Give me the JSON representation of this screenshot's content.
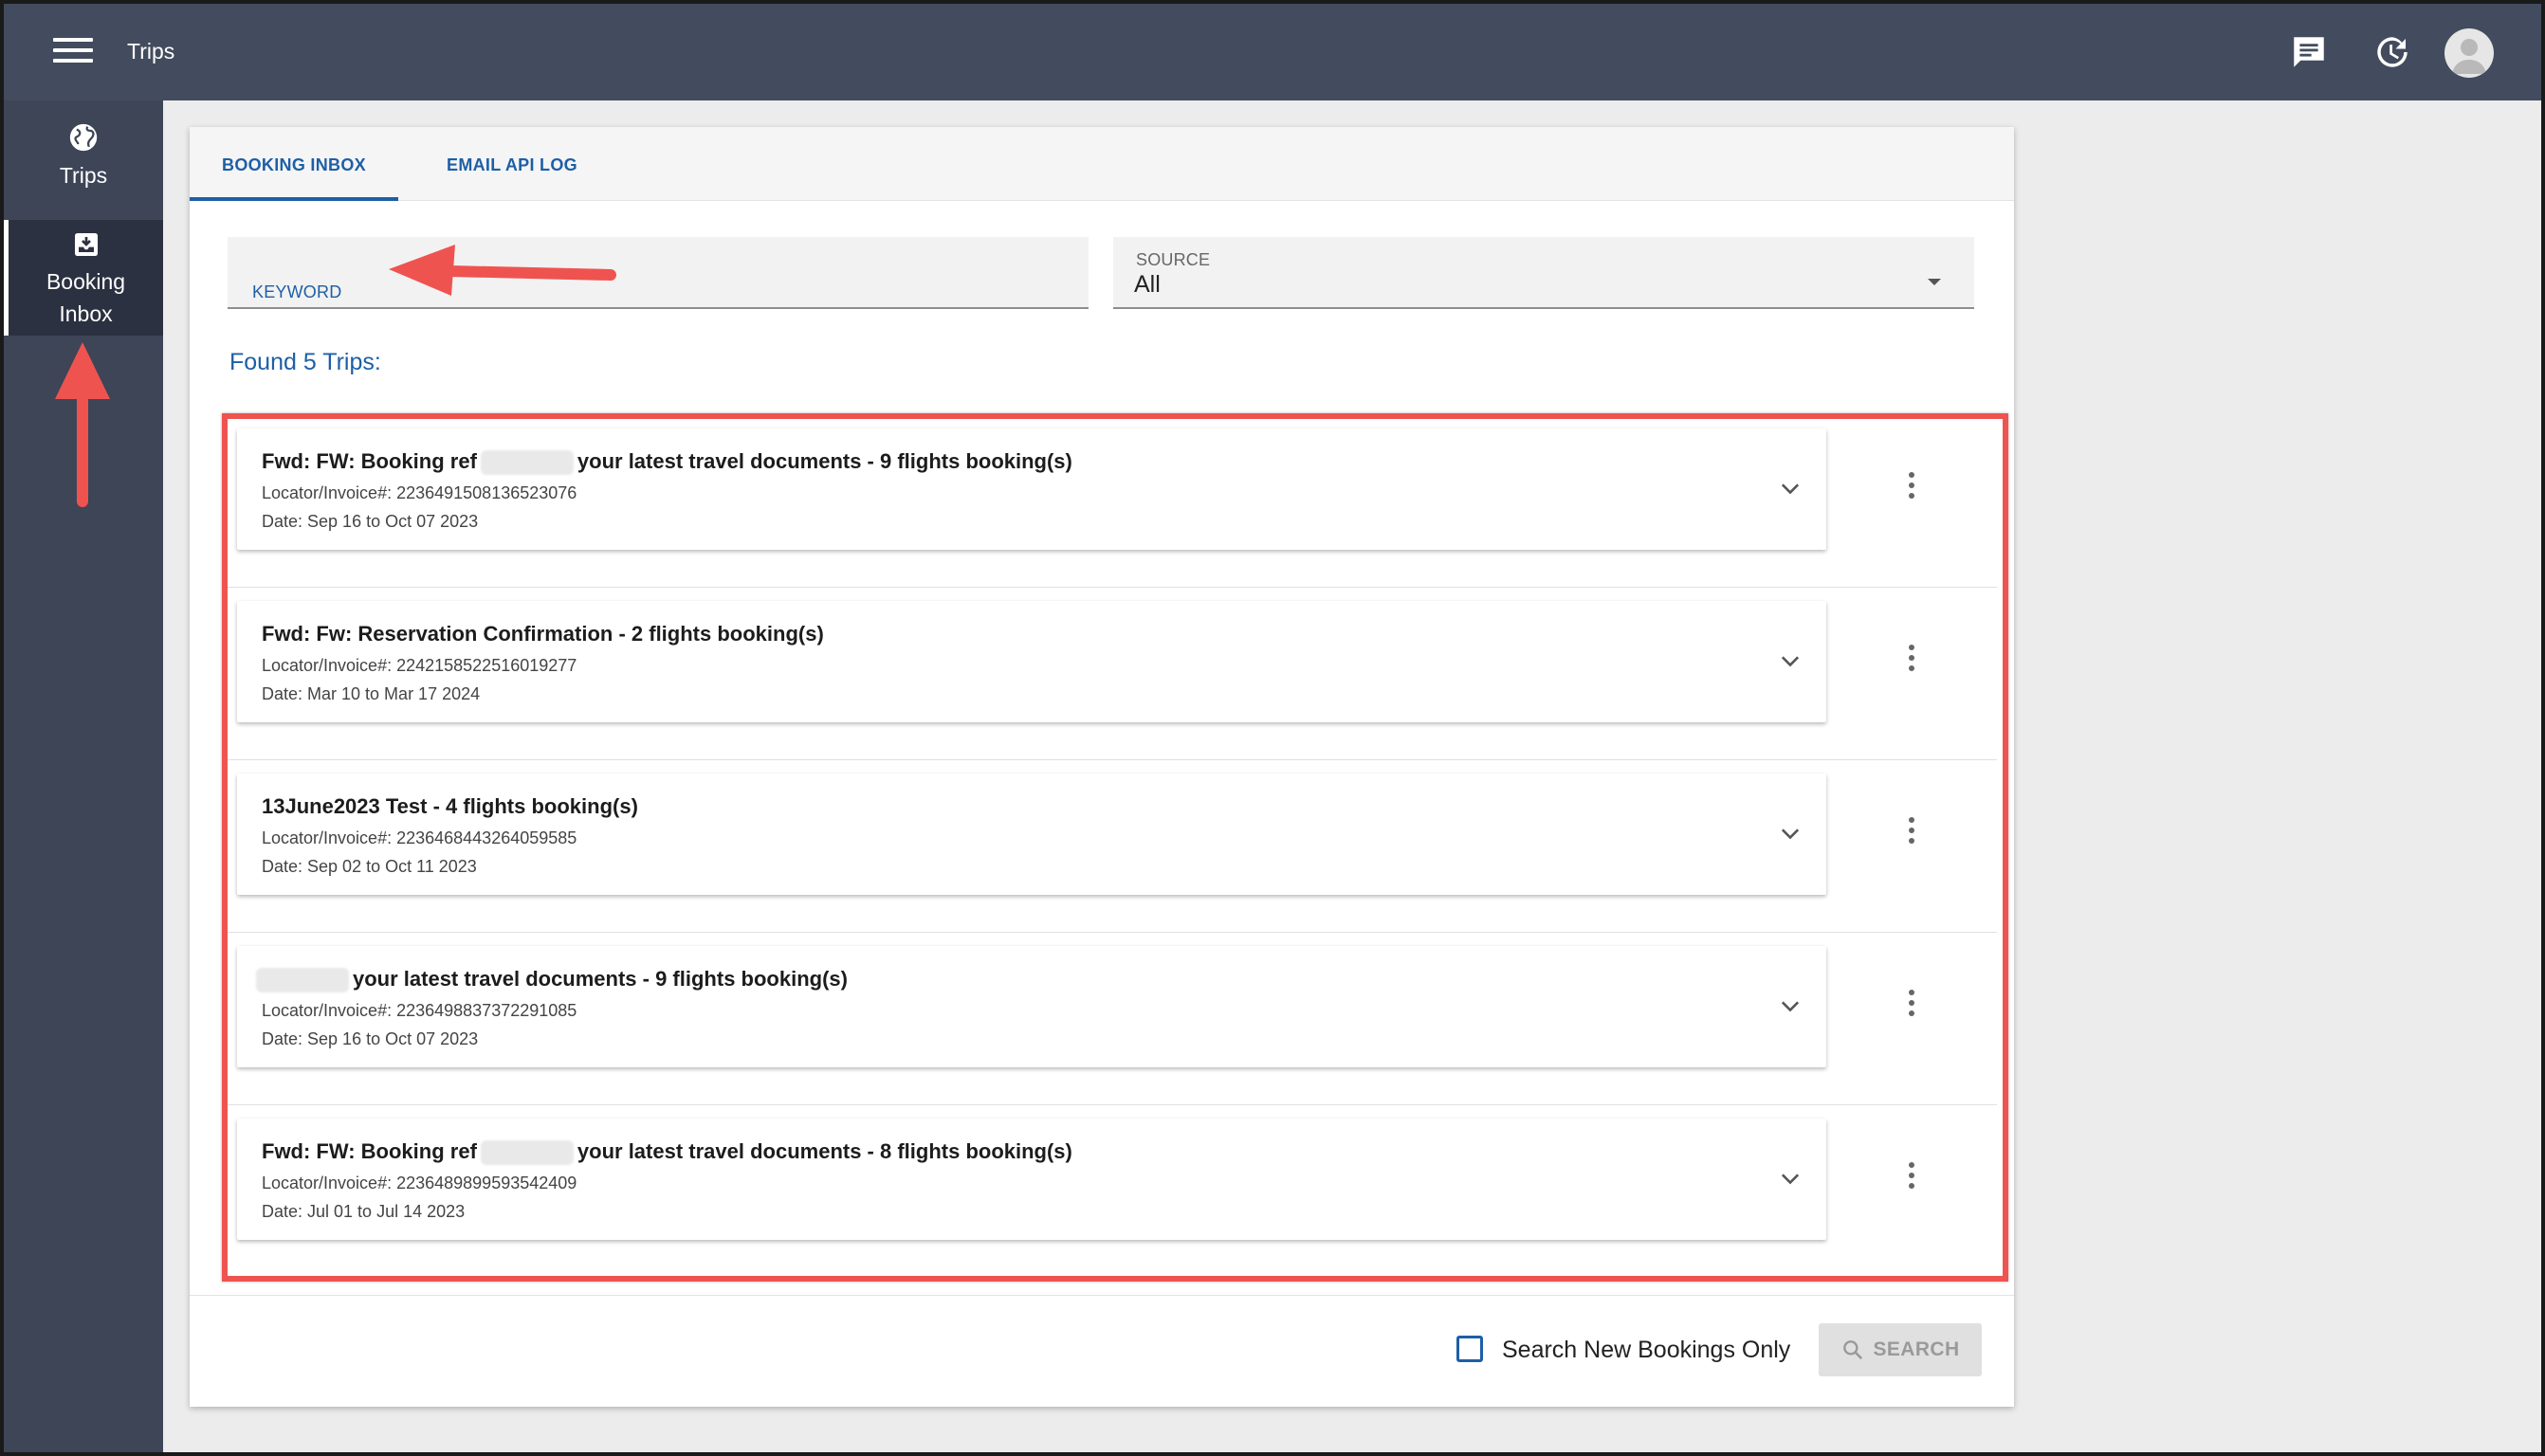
{
  "header": {
    "title": "Trips",
    "chat_icon": "chat-icon",
    "history_icon": "history-icon"
  },
  "sidebar": {
    "items": [
      {
        "icon": "globe-icon",
        "label": "Trips"
      },
      {
        "icon": "inbox-download-icon",
        "label_line1": "Booking",
        "label_line2": "Inbox",
        "active": true
      }
    ]
  },
  "tabs": [
    {
      "label": "BOOKING INBOX",
      "active": true
    },
    {
      "label": "EMAIL API LOG",
      "active": false
    }
  ],
  "filters": {
    "keyword": {
      "label": "KEYWORD",
      "value": ""
    },
    "source": {
      "label": "SOURCE",
      "value": "All"
    }
  },
  "results": {
    "summary": "Found 5 Trips:"
  },
  "trips": [
    {
      "title_prefix": "Fwd: FW: Booking ref",
      "title_suffix": "your latest travel documents - 9 flights booking(s)",
      "locator": "Locator/Invoice#: 2236491508136523076",
      "date": "Date: Sep 16 to Oct 07 2023"
    },
    {
      "title_prefix": "",
      "title_suffix": "Fwd: Fw: Reservation Confirmation - 2 flights booking(s)",
      "locator": "Locator/Invoice#: 2242158522516019277",
      "date": "Date: Mar 10 to Mar 17 2024"
    },
    {
      "title_prefix": "",
      "title_suffix": "13June2023 Test - 4 flights booking(s)",
      "locator": "Locator/Invoice#: 2236468443264059585",
      "date": "Date: Sep 02 to Oct 11 2023"
    },
    {
      "title_prefix": "",
      "title_suffix": "your latest travel documents - 9 flights booking(s)",
      "locator": "Locator/Invoice#: 2236498837372291085",
      "date": "Date: Sep 16 to Oct 07 2023"
    },
    {
      "title_prefix": "Fwd: FW: Booking ref",
      "title_suffix": "your latest travel documents - 8 flights booking(s)",
      "locator": "Locator/Invoice#: 2236489899593542409",
      "date": "Date: Jul 01 to Jul 14 2023"
    }
  ],
  "footer": {
    "checkbox_label": "Search New Bookings Only",
    "search_label": "SEARCH"
  },
  "colors": {
    "topbar": "#434c5e",
    "sidebar": "#3d4557",
    "accent": "#1d5fa6",
    "annotation": "#ef5350"
  }
}
